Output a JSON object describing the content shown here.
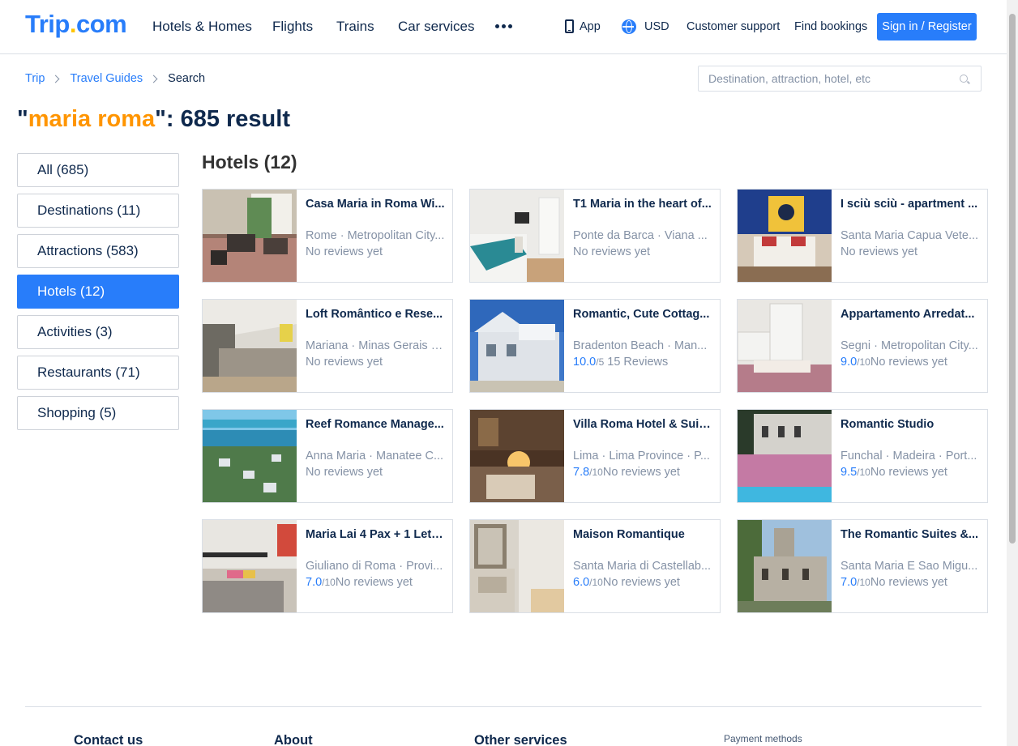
{
  "header": {
    "logo_main": "Trip",
    "logo_dot": ".",
    "logo_com": "com",
    "nav": [
      "Hotels & Homes",
      "Flights",
      "Trains",
      "Car services"
    ],
    "app_label": "App",
    "currency": "USD",
    "customer_support": "Customer support",
    "find_bookings": "Find bookings",
    "signin": "Sign in / Register"
  },
  "breadcrumb": {
    "items": [
      "Trip",
      "Travel Guides",
      "Search"
    ]
  },
  "search": {
    "placeholder": "Destination, attraction, hotel, etc"
  },
  "results": {
    "quote_open": "\"",
    "keyword": "maria roma",
    "suffix": "\": 685 result"
  },
  "sidebar": {
    "items": [
      {
        "label": "All (685)",
        "active": false
      },
      {
        "label": "Destinations (11)",
        "active": false
      },
      {
        "label": "Attractions (583)",
        "active": false
      },
      {
        "label": "Hotels (12)",
        "active": true
      },
      {
        "label": "Activities (3)",
        "active": false
      },
      {
        "label": "Restaurants (71)",
        "active": false
      },
      {
        "label": "Shopping (5)",
        "active": false
      }
    ]
  },
  "section": {
    "title": "Hotels (12)"
  },
  "hotels": [
    {
      "name": "Casa Maria in Roma Wi...",
      "location": "Rome · Metropolitan City...",
      "score": "",
      "score_max": "",
      "reviews": "No reviews yet"
    },
    {
      "name": "T1 Maria in the heart of...",
      "location": "Ponte da Barca · Viana ...",
      "score": "",
      "score_max": "",
      "reviews": "No reviews yet"
    },
    {
      "name": "I sciù sciù - apartment ...",
      "location": "Santa Maria Capua Vete...",
      "score": "",
      "score_max": "",
      "reviews": "No reviews yet"
    },
    {
      "name": "Loft Romântico e Rese...",
      "location": "Mariana · Minas Gerais · ...",
      "score": "",
      "score_max": "",
      "reviews": "No reviews yet"
    },
    {
      "name": "Romantic, Cute Cottag...",
      "location": "Bradenton Beach · Man...",
      "score": "10.0",
      "score_max": "/5",
      "reviews": "  15 Reviews"
    },
    {
      "name": "Appartamento Arredat...",
      "location": "Segni · Metropolitan City...",
      "score": "9.0",
      "score_max": "/10",
      "reviews": "No reviews yet"
    },
    {
      "name": "Reef Romance Manage...",
      "location": "Anna Maria · Manatee C...",
      "score": "",
      "score_max": "",
      "reviews": "No reviews yet"
    },
    {
      "name": "Villa Roma Hotel & Suit...",
      "location": "Lima · Lima Province · P...",
      "score": "7.8",
      "score_max": "/10",
      "reviews": "No reviews yet"
    },
    {
      "name": "Romantic Studio",
      "location": "Funchal · Madeira · Port...",
      "score": "9.5",
      "score_max": "/10",
      "reviews": "No reviews yet"
    },
    {
      "name": "Maria Lai 4 Pax + 1 Lett...",
      "location": "Giuliano di Roma · Provi...",
      "score": "7.0",
      "score_max": "/10",
      "reviews": "No reviews yet"
    },
    {
      "name": "Maison Romantique",
      "location": "Santa Maria di Castellab...",
      "score": "6.0",
      "score_max": "/10",
      "reviews": "No reviews yet"
    },
    {
      "name": "The Romantic Suites &...",
      "location": "Santa Maria E Sao Migu...",
      "score": "7.0",
      "score_max": "/10",
      "reviews": "No reviews yet"
    }
  ],
  "footer": {
    "contact": "Contact us",
    "about": "About",
    "other": "Other services",
    "payment": "Payment methods"
  },
  "colors": {
    "brand": "#287dfa",
    "keyword": "#ff9500",
    "text": "#0f294d",
    "muted": "#8592a6"
  }
}
